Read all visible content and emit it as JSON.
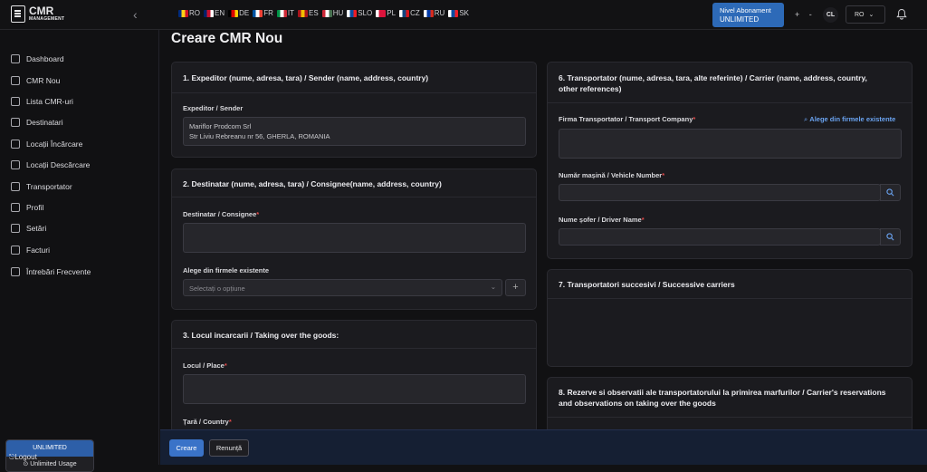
{
  "app": {
    "logo_line1": "CMR",
    "logo_line2": "MANAGEMENT"
  },
  "languages": [
    {
      "code": "RO",
      "colors": [
        "#002b7f",
        "#fcd116",
        "#ce1126"
      ]
    },
    {
      "code": "EN",
      "colors": [
        "#012169",
        "#c8102e",
        "#ffffff"
      ]
    },
    {
      "code": "DE",
      "colors": [
        "#000000",
        "#dd0000",
        "#ffce00"
      ]
    },
    {
      "code": "FR",
      "colors": [
        "#0055a4",
        "#ffffff",
        "#ef4135"
      ]
    },
    {
      "code": "IT",
      "colors": [
        "#009246",
        "#ffffff",
        "#ce2b37"
      ]
    },
    {
      "code": "ES",
      "colors": [
        "#aa151b",
        "#f1bf00",
        "#aa151b"
      ]
    },
    {
      "code": "HU",
      "colors": [
        "#ce2939",
        "#ffffff",
        "#477050"
      ]
    },
    {
      "code": "SLO",
      "colors": [
        "#ffffff",
        "#0b4ea2",
        "#ee1c25"
      ]
    },
    {
      "code": "PL",
      "colors": [
        "#ffffff",
        "#dc143c",
        "#dc143c"
      ]
    },
    {
      "code": "CZ",
      "colors": [
        "#ffffff",
        "#11457e",
        "#d7141a"
      ]
    },
    {
      "code": "RU",
      "colors": [
        "#ffffff",
        "#0039a6",
        "#d52b1e"
      ]
    },
    {
      "code": "SK",
      "colors": [
        "#ffffff",
        "#0b4ea2",
        "#ee1c25"
      ]
    }
  ],
  "header": {
    "subscription_line1": "Nivel Abonament",
    "subscription_line2": "UNLIMITED",
    "zoom_controls": "+ -",
    "avatar_initials": "CL",
    "language_selected": "RO",
    "accent": "#2d6ab8"
  },
  "sidebar": {
    "items": [
      {
        "label": "Dashboard",
        "icon": "home-icon"
      },
      {
        "label": "CMR Nou",
        "icon": "plus-icon"
      },
      {
        "label": "Lista CMR-uri",
        "icon": "document-icon"
      },
      {
        "label": "Destinatari",
        "icon": "users-icon"
      },
      {
        "label": "Locații Încărcare",
        "icon": "map-pin-icon"
      },
      {
        "label": "Locații Descărcare",
        "icon": "map-icon"
      },
      {
        "label": "Transportator",
        "icon": "truck-icon"
      },
      {
        "label": "Profil",
        "icon": "user-icon"
      },
      {
        "label": "Setări",
        "icon": "gear-icon"
      },
      {
        "label": "Facturi",
        "icon": "invoice-icon"
      },
      {
        "label": "Întrebări Frecvente",
        "icon": "help-icon"
      }
    ],
    "plan_name": "UNLIMITED",
    "plan_usage": "Unlimited Usage",
    "logout": "Logout"
  },
  "page": {
    "title": "Creare CMR Nou"
  },
  "sections": {
    "sender": {
      "title": "1. Expeditor (nume, adresa, tara) / Sender (name, address, country)",
      "field_label": "Expeditor / Sender",
      "value_line1": "Mariflor Prodcom Srl",
      "value_line2": "Str Liviu Rebreanu nr 56, GHERLA, ROMANIA"
    },
    "consignee": {
      "title": "2. Destinatar (nume, adresa, tara) / Consignee(name, address, country)",
      "field_label": "Destinatar / Consignee",
      "select_label": "Alege din firmele existente",
      "select_placeholder": "Selectați o opțiune"
    },
    "taking_over": {
      "title": "3. Locul incarcarii / Taking over the goods:",
      "place_label": "Locul / Place",
      "country_label": "Țară / Country"
    },
    "carrier": {
      "title_line1": "6. Transportator (nume, adresa, tara, alte referinte) / Carrier (name, address, country,",
      "title_line2": "other references)",
      "company_label": "Firma Transportator / Transport Company",
      "choose_link": "Alege din firmele existente",
      "vehicle_label": "Număr mașină / Vehicle Number",
      "driver_label": "Nume șofer / Driver Name"
    },
    "successive": {
      "title": "7. Transportatori succesivi / Successive carriers"
    },
    "reservations": {
      "title_line1": "8. Rezerve si observatii ale transportatorului la primirea marfurilor / Carrier's reservations",
      "title_line2": "and observations on taking over the goods"
    }
  },
  "footer": {
    "create_label": "Creare",
    "cancel_label": "Renunță"
  }
}
